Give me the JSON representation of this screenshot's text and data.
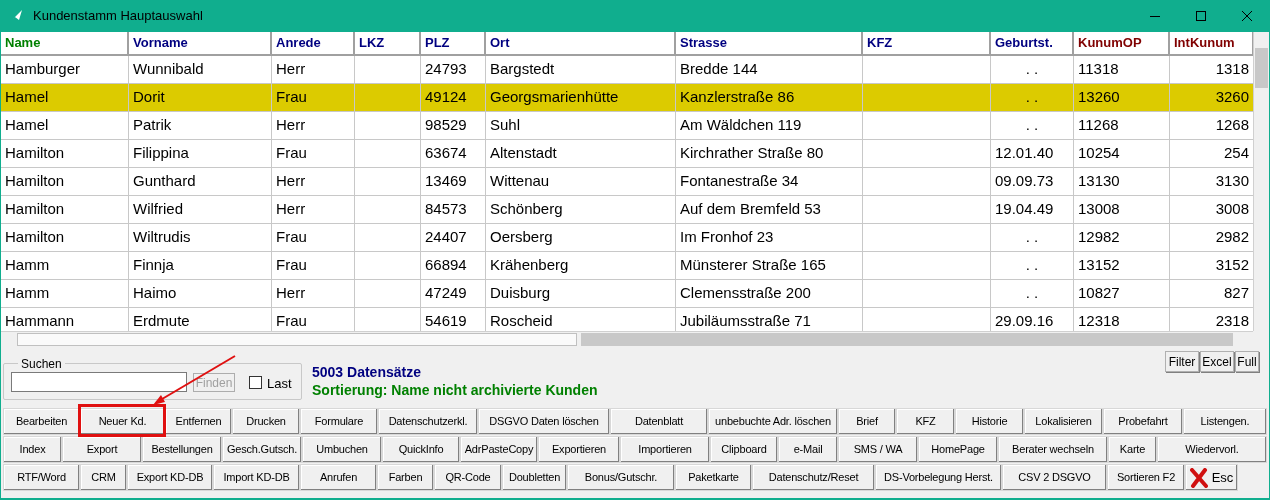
{
  "window": {
    "title": "Kundenstamm Hauptauswahl"
  },
  "table": {
    "columns": [
      {
        "label": "Name",
        "kind": "sort"
      },
      {
        "label": "Vorname",
        "kind": "normal"
      },
      {
        "label": "Anrede",
        "kind": "normal"
      },
      {
        "label": "LKZ",
        "kind": "normal"
      },
      {
        "label": "PLZ",
        "kind": "normal"
      },
      {
        "label": "Ort",
        "kind": "normal"
      },
      {
        "label": "Strasse",
        "kind": "normal"
      },
      {
        "label": "KFZ",
        "kind": "normal"
      },
      {
        "label": "Geburtst.",
        "kind": "normal"
      },
      {
        "label": "KunumOP",
        "kind": "number"
      },
      {
        "label": "IntKunum",
        "kind": "number"
      }
    ],
    "rows": [
      {
        "selected": false,
        "cells": [
          "Hamburger",
          "Wunnibald",
          "Herr",
          "",
          "24793",
          "Bargstedt",
          "Bredde 144",
          "",
          ". .",
          "11318",
          "1318"
        ]
      },
      {
        "selected": true,
        "cells": [
          "Hamel",
          "Dorit",
          "Frau",
          "",
          "49124",
          "Georgsmarienhütte",
          "Kanzlerstraße 86",
          "",
          ". .",
          "13260",
          "3260"
        ]
      },
      {
        "selected": false,
        "cells": [
          "Hamel",
          "Patrik",
          "Herr",
          "",
          "98529",
          "Suhl",
          "Am Wäldchen 119",
          "",
          ". .",
          "11268",
          "1268"
        ]
      },
      {
        "selected": false,
        "cells": [
          "Hamilton",
          "Filippina",
          "Frau",
          "",
          "63674",
          "Altenstadt",
          "Kirchrather Straße 80",
          "",
          "12.01.40",
          "10254",
          "254"
        ]
      },
      {
        "selected": false,
        "cells": [
          "Hamilton",
          "Gunthard",
          "Herr",
          "",
          "13469",
          "Wittenau",
          "Fontanestraße 34",
          "",
          "09.09.73",
          "13130",
          "3130"
        ]
      },
      {
        "selected": false,
        "cells": [
          "Hamilton",
          "Wilfried",
          "Herr",
          "",
          "84573",
          "Schönberg",
          "Auf dem Bremfeld 53",
          "",
          "19.04.49",
          "13008",
          "3008"
        ]
      },
      {
        "selected": false,
        "cells": [
          "Hamilton",
          "Wiltrudis",
          "Frau",
          "",
          "24407",
          "Oersberg",
          "Im Fronhof 23",
          "",
          ". .",
          "12982",
          "2982"
        ]
      },
      {
        "selected": false,
        "cells": [
          "Hamm",
          "Finnja",
          "Frau",
          "",
          "66894",
          "Krähenberg",
          "Münsterer Straße 165",
          "",
          ". .",
          "13152",
          "3152"
        ]
      },
      {
        "selected": false,
        "cells": [
          "Hamm",
          "Haimo",
          "Herr",
          "",
          "47249",
          "Duisburg",
          "Clemensstraße 200",
          "",
          ". .",
          "10827",
          "827"
        ]
      },
      {
        "selected": false,
        "cells": [
          "Hammann",
          "Erdmute",
          "Frau",
          "",
          "54619",
          "Roscheid",
          "Jubiläumsstraße 71",
          "",
          "29.09.16",
          "12318",
          "2318"
        ]
      }
    ]
  },
  "search": {
    "label": "Suchen",
    "button": "Finden",
    "button_disabled": true,
    "last_label": "Last",
    "last_checked": false
  },
  "info": {
    "count": "5003 Datensätze",
    "sorting": "Sortierung: Name nicht archivierte Kunden"
  },
  "view_buttons": [
    "Filter",
    "Excel",
    "Full"
  ],
  "button_rows": [
    [
      "Bearbeiten",
      "Neuer Kd.",
      "Entfernen",
      "Drucken",
      "Formulare",
      "Datenschutzerkl.",
      "DSGVO Daten löschen",
      "Datenblatt",
      "unbebuchte Adr. löschen",
      "Brief",
      "KFZ",
      "Historie",
      "Lokalisieren",
      "Probefahrt",
      "Listengen."
    ],
    [
      "Index",
      "Export",
      "Bestellungen",
      "Gesch.Gutsch.",
      "Umbuchen",
      "QuickInfo",
      "AdrPasteCopy",
      "Exportieren",
      "Importieren",
      "Clipboard",
      "e-Mail",
      "SMS / WA",
      "HomePage",
      "Berater wechseln",
      "Karte",
      "Wiedervorl."
    ],
    [
      "RTF/Word",
      "CRM",
      "Export KD-DB",
      "Import KD-DB",
      "Anrufen",
      "Farben",
      "QR-Code",
      "Doubletten",
      "Bonus/Gutschr.",
      "Paketkarte",
      "Datenschutz/Reset",
      "DS-Vorbelegung Herst.",
      "CSV 2 DSGVO",
      "Sortieren F2"
    ]
  ],
  "esc_button": "Esc"
}
